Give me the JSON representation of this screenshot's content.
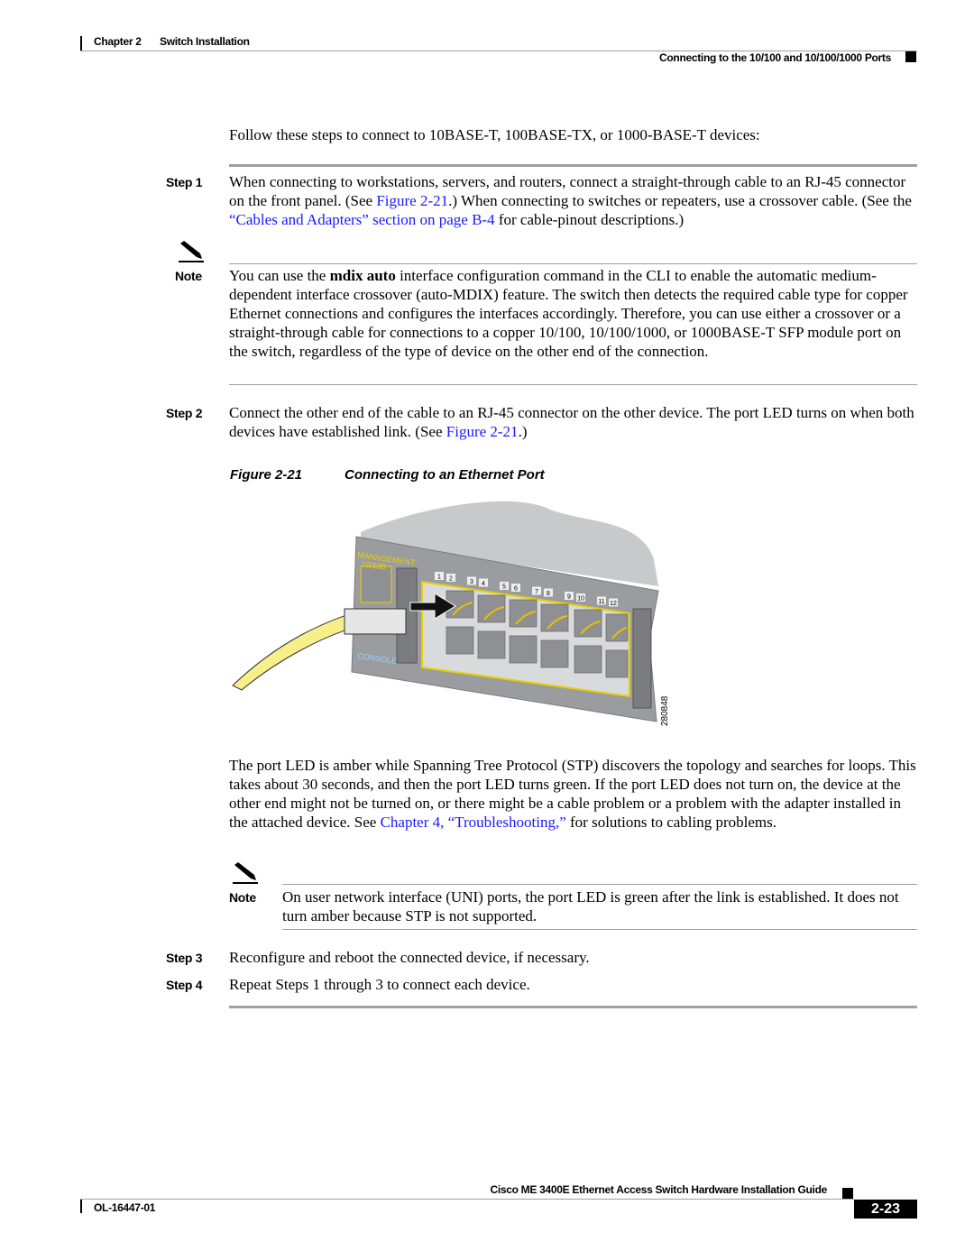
{
  "header": {
    "chapter": "Chapter 2",
    "chapter_title": "Switch Installation",
    "section": "Connecting to the 10/100 and 10/100/1000 Ports"
  },
  "intro": "Follow these steps to connect to 10BASE-T, 100BASE-TX, or 1000-BASE-T devices:",
  "step1": {
    "label": "Step 1",
    "t1": "When connecting to workstations, servers, and routers, connect a straight-through cable to an RJ-45 connector on the front panel. (See ",
    "link1": "Figure 2-21",
    "t2": ".) When connecting to switches or repeaters, use a crossover cable. (See the ",
    "link2": "“Cables and Adapters” section on page B-4",
    "t3": " for cable-pinout descriptions.)"
  },
  "note1": {
    "label": "Note",
    "t1": "You can use the ",
    "bold": "mdix auto",
    "t2": " interface configuration command in the CLI to enable the automatic medium-dependent interface crossover (auto-MDIX) feature. The switch then detects the required cable type for copper Ethernet connections and configures the interfaces accordingly. Therefore, you can use either a crossover or a straight-through cable for connections to a copper 10/100, 10/100/1000, or 1000BASE-T SFP module port on the switch, regardless of the type of device on the other end of the connection."
  },
  "step2": {
    "label": "Step 2",
    "t1": "Connect the other end of the cable to an RJ-45 connector on the other device. The port LED turns on when both devices have established link. (See ",
    "link1": "Figure 2-21",
    "t2": ".)"
  },
  "figure": {
    "number": "Figure 2-21",
    "title": "Connecting to an Ethernet Port",
    "id_label": "280848",
    "panel_labels": {
      "management": "MANAGEMENT",
      "mgmt_speed": "10/100",
      "console": "CONSOLE"
    },
    "port_numbers": [
      "1",
      "2",
      "3",
      "4",
      "5",
      "6",
      "7",
      "8",
      "9",
      "10",
      "11",
      "12"
    ]
  },
  "para": {
    "t1": "The port LED is amber while Spanning Tree Protocol (STP) discovers the topology and searches for loops. This takes about 30 seconds, and then the port LED turns green. If the port LED does not turn on, the device at the other end might not be turned on, or there might be a cable problem or a problem with the adapter installed in the attached device. See ",
    "link1": "Chapter 4, “Troubleshooting,”",
    "t2": " for solutions to cabling problems."
  },
  "note2": {
    "label": "Note",
    "text": "On user network interface (UNI) ports, the port LED is green after the link is established. It does not turn amber because STP is not supported."
  },
  "step3": {
    "label": "Step 3",
    "text": "Reconfigure and reboot the connected device, if necessary."
  },
  "step4": {
    "label": "Step 4",
    "text": "Repeat Steps 1 through 3 to connect each device."
  },
  "footer": {
    "guide_title": "Cisco ME 3400E Ethernet Access Switch Hardware Installation Guide",
    "doc_number": "OL-16447-01",
    "page": "2-23"
  },
  "colors": {
    "link": "#1a1aff",
    "rule": "#a0a0a0",
    "cable": "#f7f08a",
    "port_outline": "#e8d000"
  }
}
